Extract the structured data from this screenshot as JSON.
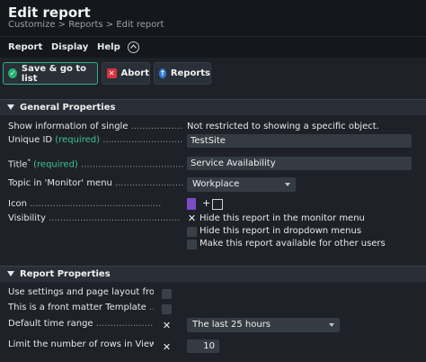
{
  "header": {
    "title": "Edit report",
    "breadcrumb": "Customize > Reports > Edit report"
  },
  "menu": {
    "items": [
      "Report",
      "Display",
      "Help"
    ],
    "toggle_icon": "chevron-up-icon"
  },
  "toolbar": {
    "save_label": "Save & go to list",
    "abort_label": "Abort",
    "reports_label": "Reports"
  },
  "general": {
    "title": "General Properties",
    "show_info_label": "Show information of single",
    "show_info_value": "Not restricted to showing a specific object.",
    "unique_id_label": "Unique ID",
    "unique_id_req": "(required)",
    "unique_id_value": "TestSite",
    "title_label": "Title",
    "title_asterisk": "*",
    "title_req": "(required)",
    "title_value": "Service Availability",
    "topic_label": "Topic in 'Monitor' menu",
    "topic_value": "Workplace",
    "icon_label": "Icon",
    "icon_plus": "+",
    "visibility_label": "Visibility",
    "visibility_options": [
      "Hide this report in the monitor menu",
      "Hide this report in dropdown menus",
      "Make this report available for other users"
    ]
  },
  "report_props": {
    "title": "Report Properties",
    "use_settings_label": "Use settings and page layout from",
    "front_matter_label": "This is a front matter Template",
    "default_time_label": "Default time range",
    "default_time_value": "The last 25 hours",
    "limit_rows_label": "Limit the number of rows in View tab",
    "limit_rows_value": "10"
  },
  "colors": {
    "accent_green": "#3fc28f",
    "background": "#1e2228",
    "header_bg": "#14181d"
  }
}
